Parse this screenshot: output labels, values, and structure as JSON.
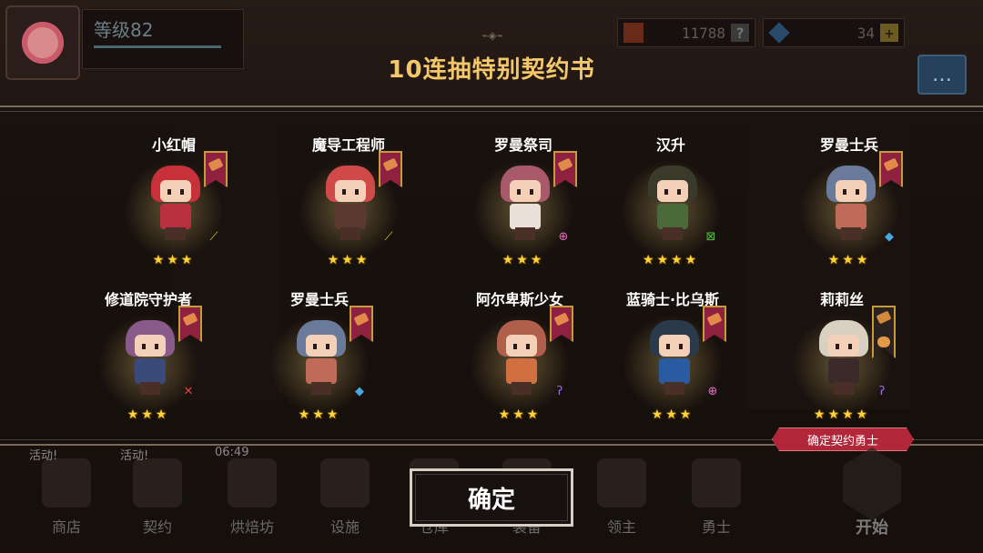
{
  "hud": {
    "level_label": "等级82",
    "gold": "11788",
    "gems": "34",
    "plus": "+"
  },
  "title": "10连抽特别契约书",
  "heroes": [
    {
      "name": "小红帽",
      "stars": "★★★",
      "hair": "#c8303a",
      "body": "#b83040",
      "weapon": "sword-icon",
      "weapon_glyph": "⟋",
      "weapon_color": "#e0c040",
      "banner": "normal"
    },
    {
      "name": "魔导工程师",
      "stars": "★★★",
      "hair": "#d04a4a",
      "body": "#5a3a2e",
      "weapon": "sword-icon",
      "weapon_glyph": "⟋",
      "weapon_color": "#e0c040",
      "banner": "normal"
    },
    {
      "name": "罗曼祭司",
      "stars": "★★★",
      "hair": "#a85a6a",
      "body": "#eae0d8",
      "weapon": "staff-icon",
      "weapon_glyph": "⊕",
      "weapon_color": "#e070c0",
      "banner": "normal"
    },
    {
      "name": "汉升",
      "stars": "★★★★",
      "hair": "#3a3a2a",
      "body": "#4a6a3a",
      "weapon": "bow-icon",
      "weapon_glyph": "⊠",
      "weapon_color": "#50c040",
      "banner": "none"
    },
    {
      "name": "罗曼士兵",
      "stars": "★★★",
      "hair": "#6a7a9a",
      "body": "#c06a5a",
      "weapon": "axe-icon",
      "weapon_glyph": "◆",
      "weapon_color": "#4aa8e0",
      "banner": "normal"
    },
    {
      "name": "修道院守护者",
      "stars": "★★★",
      "hair": "#8a5a8a",
      "body": "#3a4a7a",
      "weapon": "blade-icon",
      "weapon_glyph": "✕",
      "weapon_color": "#e04040",
      "banner": "normal"
    },
    {
      "name": "罗曼士兵",
      "stars": "★★★",
      "hair": "#6a7a9a",
      "body": "#c06a5a",
      "weapon": "axe-icon",
      "weapon_glyph": "◆",
      "weapon_color": "#4aa8e0",
      "banner": "normal"
    },
    {
      "name": "阿尔卑斯少女",
      "stars": "★★★",
      "hair": "#b0604a",
      "body": "#d07040",
      "weapon": "hook-icon",
      "weapon_glyph": "ʔ",
      "weapon_color": "#a070e0",
      "banner": "normal"
    },
    {
      "name": "蓝骑士·比乌斯",
      "stars": "★★★",
      "hair": "#2a3a4a",
      "body": "#2a5aa0",
      "weapon": "staff-icon",
      "weapon_glyph": "⊕",
      "weapon_color": "#e070c0",
      "banner": "normal"
    },
    {
      "name": "莉莉丝",
      "stars": "★★★★",
      "hair": "#d8d0c0",
      "body": "#3a2a2a",
      "weapon": "hook-icon",
      "weapon_glyph": "ʔ",
      "weapon_color": "#a070e0",
      "banner": "tall"
    }
  ],
  "confirm_tag": "确定契约勇士",
  "ok_button": "确定",
  "nav": [
    {
      "label": "商店",
      "badge": "活动!"
    },
    {
      "label": "契约",
      "badge": "活动!"
    },
    {
      "label": "烘焙坊",
      "badge": "06:49"
    },
    {
      "label": "设施",
      "badge": ""
    },
    {
      "label": "仓库",
      "badge": ""
    },
    {
      "label": "装备",
      "badge": ""
    },
    {
      "label": "领主",
      "badge": ""
    },
    {
      "label": "勇士",
      "badge": ""
    }
  ],
  "start_button": "开始"
}
